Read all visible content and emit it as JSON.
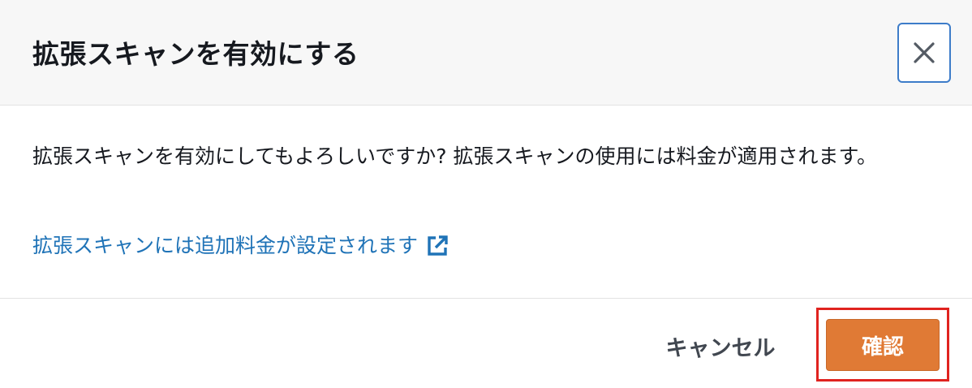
{
  "dialog": {
    "title": "拡張スキャンを有効にする",
    "close_icon": "close-icon",
    "message": "拡張スキャンを有効にしてもよろしいですか? 拡張スキャンの使用には料金が適用されます。",
    "link_text": "拡張スキャンには追加料金が設定されます",
    "link_icon": "external-link-icon"
  },
  "footer": {
    "cancel_label": "キャンセル",
    "confirm_label": "確認"
  },
  "colors": {
    "link": "#1f73b7",
    "primary_button": "#e07a35",
    "close_border": "#3d7cc9",
    "highlight": "#e0231f"
  }
}
